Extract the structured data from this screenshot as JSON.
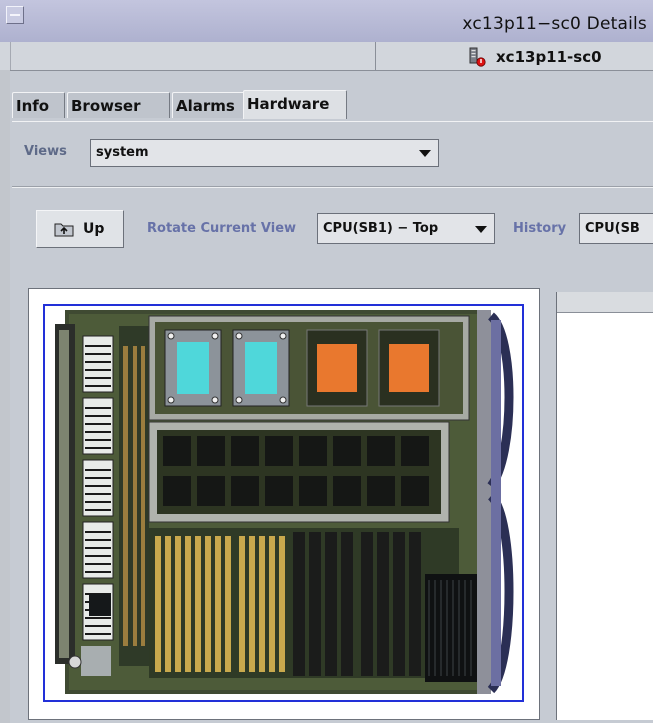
{
  "window": {
    "title": "xc13p11−sc0 Details"
  },
  "host": {
    "name": "xc13p11-sc0",
    "icon": "server-alarm-icon"
  },
  "tabs": [
    {
      "label": "Info",
      "active": false
    },
    {
      "label": "Browser",
      "active": false
    },
    {
      "label": "Alarms",
      "active": false
    },
    {
      "label": "Hardware",
      "active": true
    }
  ],
  "views": {
    "label": "Views",
    "value": "system"
  },
  "toolbar": {
    "up_label": "Up",
    "rotate_label": "Rotate Current View",
    "rotate_value": "CPU(SB1) − Top",
    "history_label": "History",
    "history_value": "CPU(SB"
  },
  "colors": {
    "highlight_border": "#2230d8",
    "label_blue": "#6772a8"
  },
  "board_image": "cpu-system-board-top-view"
}
